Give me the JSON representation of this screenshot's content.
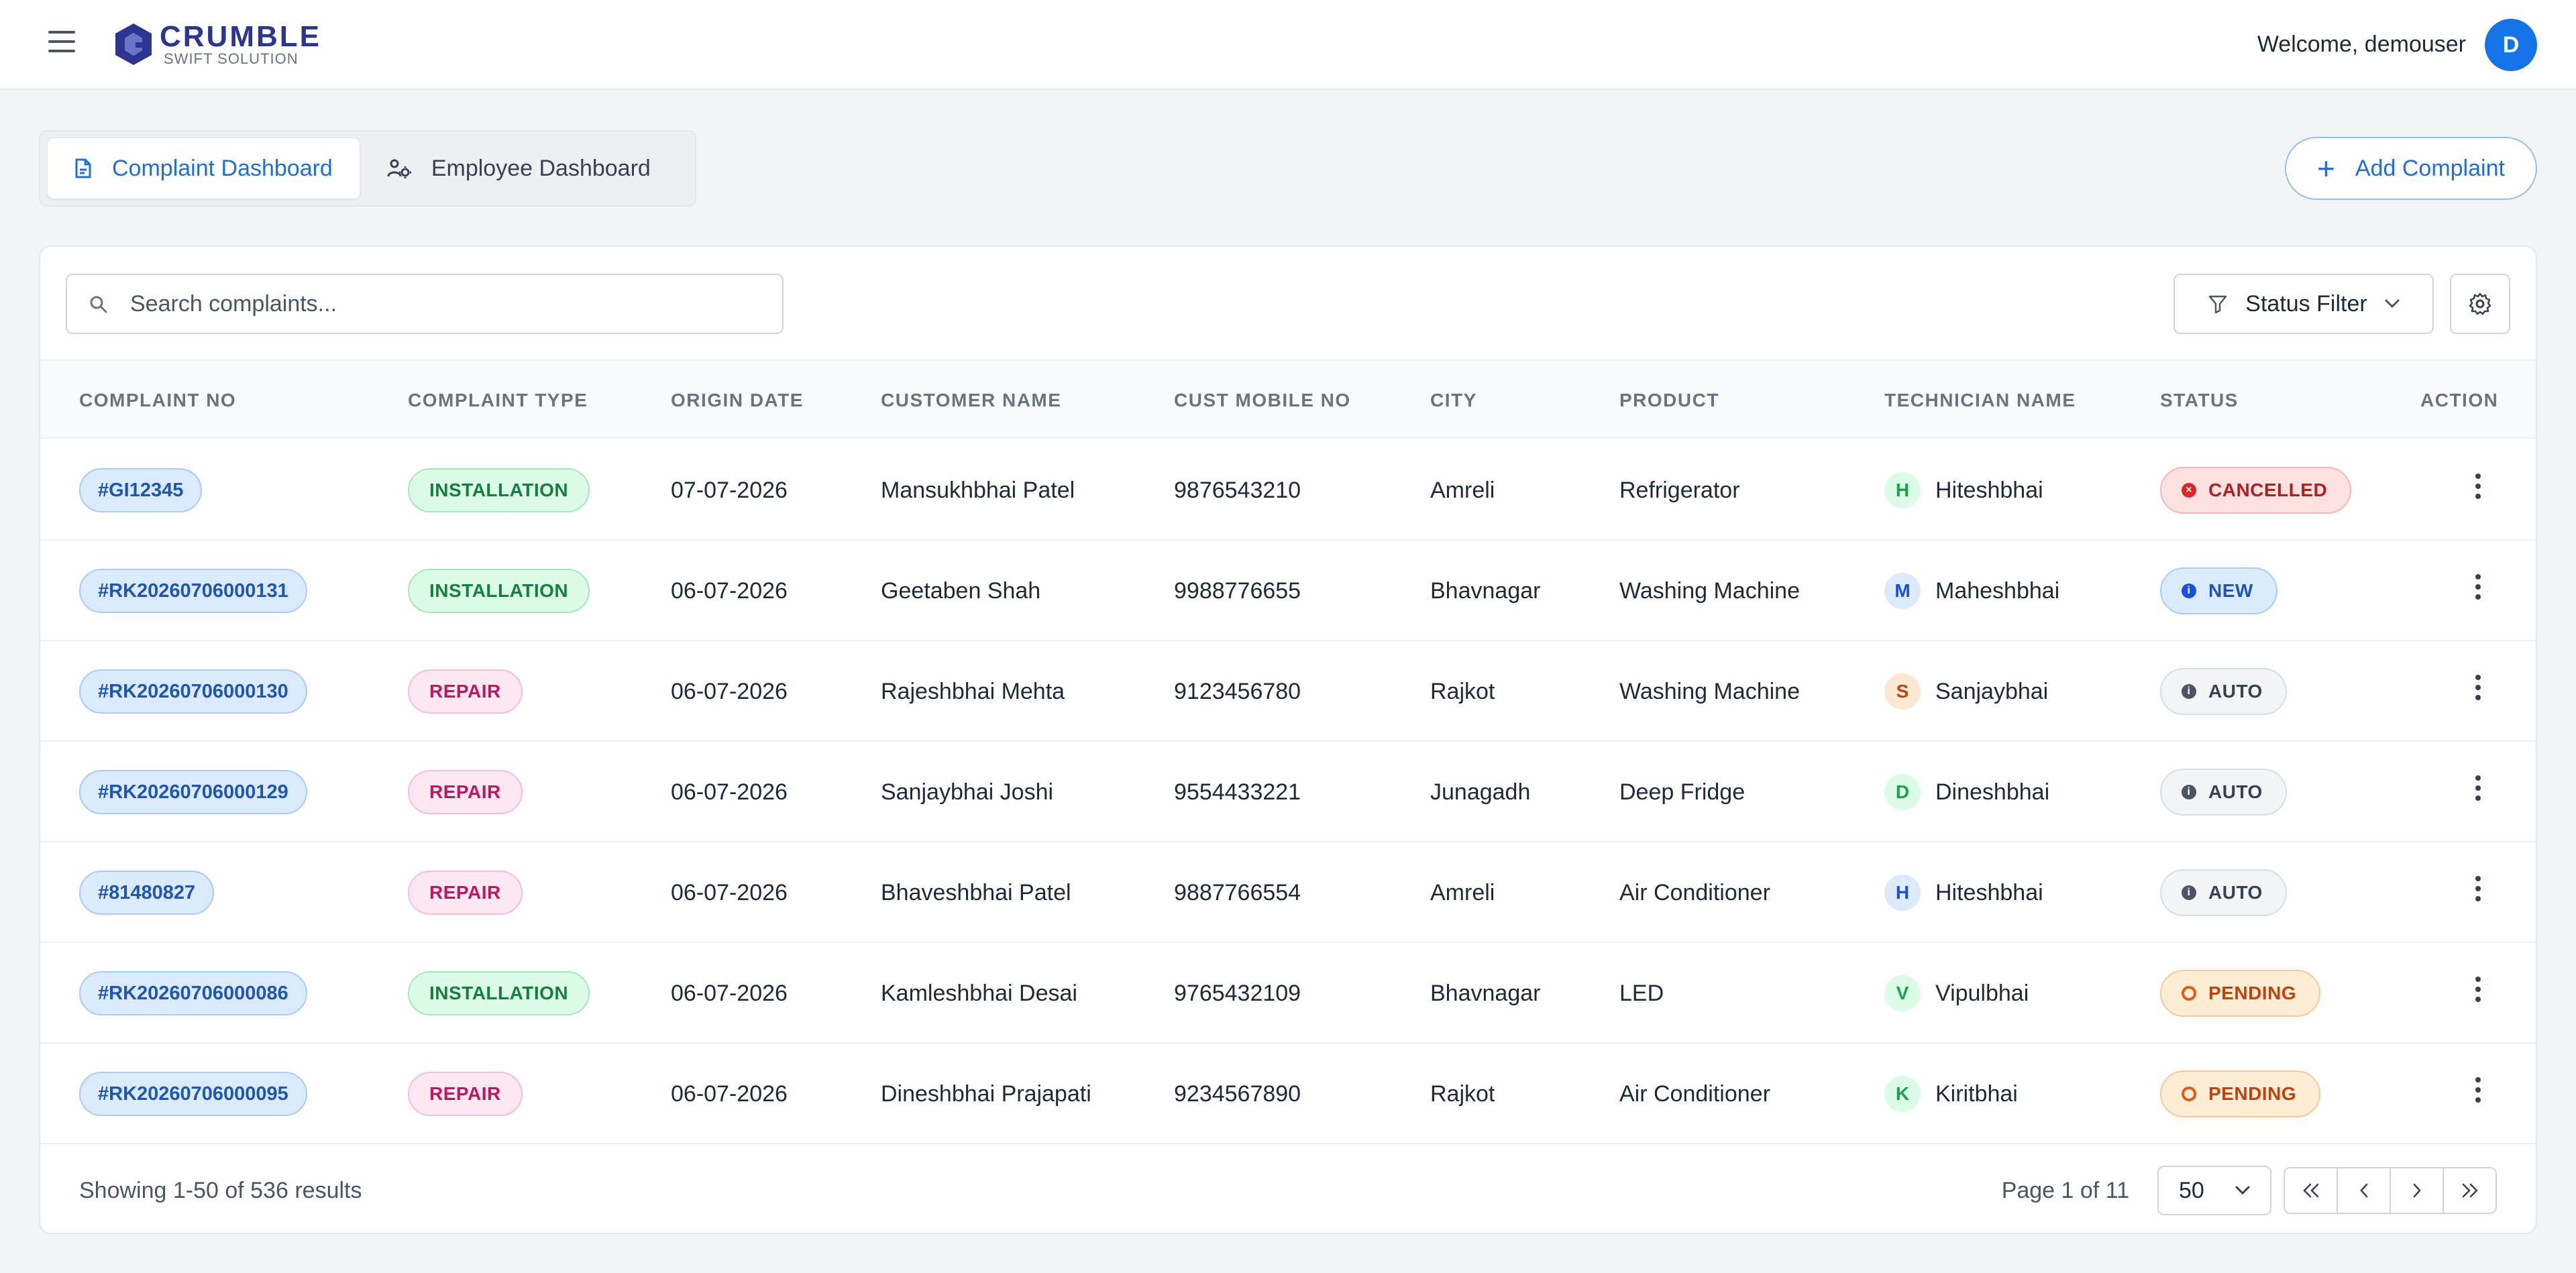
{
  "header": {
    "brand_name": "CRUMBLE",
    "brand_tagline": "SWIFT SOLUTION",
    "welcome": "Welcome, demouser",
    "avatar_initial": "D"
  },
  "tabs": [
    {
      "label": "Complaint Dashboard",
      "active": true
    },
    {
      "label": "Employee Dashboard",
      "active": false
    }
  ],
  "add_button": {
    "label": "Add Complaint"
  },
  "search": {
    "placeholder": "Search complaints...",
    "value": ""
  },
  "status_filter": {
    "label": "Status Filter"
  },
  "table": {
    "columns": [
      "COMPLAINT NO",
      "COMPLAINT TYPE",
      "ORIGIN DATE",
      "CUSTOMER NAME",
      "CUST MOBILE NO",
      "CITY",
      "PRODUCT",
      "TECHNICIAN NAME",
      "STATUS",
      "ACTION"
    ],
    "rows": [
      {
        "no": "#GI12345",
        "type": "INSTALLATION",
        "date": "07-07-2026",
        "customer": "Mansukhbhai Patel",
        "mobile": "9876543210",
        "city": "Amreli",
        "product": "Refrigerator",
        "tech_initial": "H",
        "tech": "Hiteshbhai",
        "tech_color": "green",
        "status": "CANCELLED"
      },
      {
        "no": "#RK20260706000131",
        "type": "INSTALLATION",
        "date": "06-07-2026",
        "customer": "Geetaben Shah",
        "mobile": "9988776655",
        "city": "Bhavnagar",
        "product": "Washing Machine",
        "tech_initial": "M",
        "tech": "Maheshbhai",
        "tech_color": "blue",
        "status": "NEW"
      },
      {
        "no": "#RK20260706000130",
        "type": "REPAIR",
        "date": "06-07-2026",
        "customer": "Rajeshbhai Mehta",
        "mobile": "9123456780",
        "city": "Rajkot",
        "product": "Washing Machine",
        "tech_initial": "S",
        "tech": "Sanjaybhai",
        "tech_color": "orange",
        "status": "AUTO"
      },
      {
        "no": "#RK20260706000129",
        "type": "REPAIR",
        "date": "06-07-2026",
        "customer": "Sanjaybhai Joshi",
        "mobile": "9554433221",
        "city": "Junagadh",
        "product": "Deep Fridge",
        "tech_initial": "D",
        "tech": "Dineshbhai",
        "tech_color": "green",
        "status": "AUTO"
      },
      {
        "no": "#81480827",
        "type": "REPAIR",
        "date": "06-07-2026",
        "customer": "Bhaveshbhai Patel",
        "mobile": "9887766554",
        "city": "Amreli",
        "product": "Air Conditioner",
        "tech_initial": "H",
        "tech": "Hiteshbhai",
        "tech_color": "blue",
        "status": "AUTO"
      },
      {
        "no": "#RK20260706000086",
        "type": "INSTALLATION",
        "date": "06-07-2026",
        "customer": "Kamleshbhai Desai",
        "mobile": "9765432109",
        "city": "Bhavnagar",
        "product": "LED",
        "tech_initial": "V",
        "tech": "Vipulbhai",
        "tech_color": "green",
        "status": "PENDING"
      },
      {
        "no": "#RK20260706000095",
        "type": "REPAIR",
        "date": "06-07-2026",
        "customer": "Dineshbhai Prajapati",
        "mobile": "9234567890",
        "city": "Rajkot",
        "product": "Air Conditioner",
        "tech_initial": "K",
        "tech": "Kiritbhai",
        "tech_color": "green",
        "status": "PENDING"
      }
    ]
  },
  "footer": {
    "showing": "Showing 1-50 of 536 results",
    "page_info": "Page 1 of 11",
    "page_size": "50"
  },
  "icons": {
    "menu": "hamburger-menu-icon",
    "complaint_tab": "document-icon",
    "employee_tab": "users-gear-icon",
    "add": "plus-icon",
    "search": "search-icon",
    "filter": "filter-funnel-icon",
    "settings": "gear-icon",
    "row_action": "kebab-menu-icon"
  },
  "colors": {
    "accent": "#1f6fd6",
    "brand": "#2c3590",
    "avatar_bg": "#1473e6"
  }
}
